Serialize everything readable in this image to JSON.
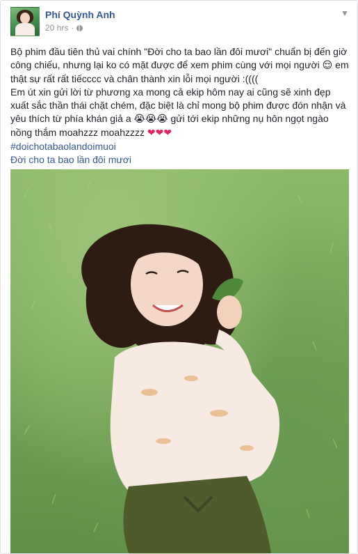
{
  "post": {
    "author": "Phí Quỳnh Anh",
    "time": "20 hrs",
    "separator": "·",
    "privacy_icon": "globe-icon",
    "menu_icon": "chevron-down-icon",
    "text_line1": "Bộ phim đầu tiên thủ vai chính \"Đời cho ta bao lần đôi mươi\" chuẩn bị đến giờ công chiếu, nhưng lại ko có mặt được để xem phim cùng với mọi người",
    "text_line1_emoji": "😌",
    "text_line1_tail": " em thật sự rất rất tiếcccc và chân thành xin lỗi mọi người :((((",
    "text_line2": "Em út xin gửi lời từ phương xa mong cả ekip hôm nay ai cũng sẽ xinh đẹp xuất sắc thần thái chặt chém, đặc biệt là chỉ mong bộ phim được đón nhận và yêu thích từ phía khán giả a ",
    "text_line2_emoji": "😭😭😭",
    "text_line2_tail": " gửi tới ekip những nụ hôn ngọt ngào nồng thắm moahzzz moahzzzz ",
    "hearts": "❤❤❤",
    "hashtag": "#doichotabaolandoimuoi",
    "title_link": "Đời cho ta bao lần đôi mươi"
  },
  "colors": {
    "link": "#365899",
    "text": "#1d2129",
    "meta": "#90949c",
    "heart": "#e0245e",
    "grass": "#78a85a"
  }
}
